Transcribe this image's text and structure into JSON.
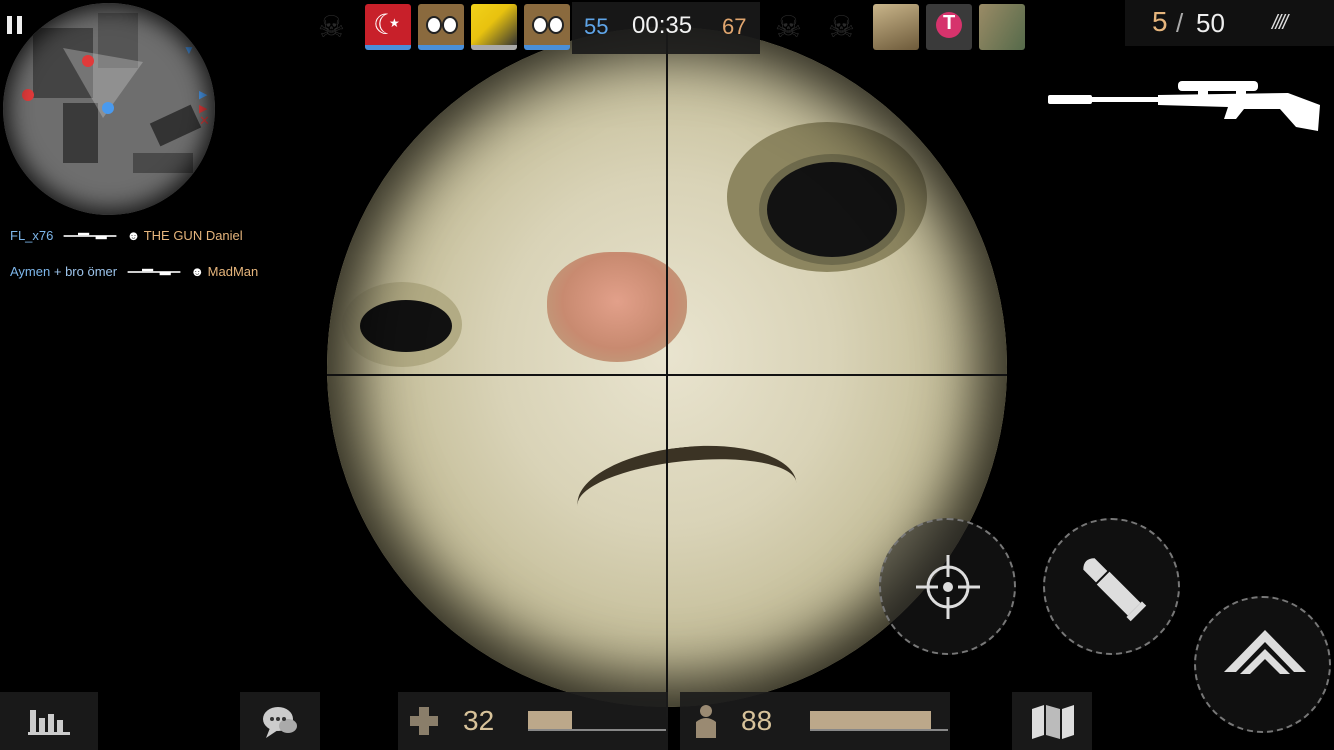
{
  "top": {
    "score_blue": "55",
    "timer": "00:35",
    "score_red": "67"
  },
  "ammo": {
    "current": "5",
    "separator": "/",
    "total": "50",
    "mags": "////"
  },
  "killfeed": [
    {
      "killer": "FL_x76",
      "assist": "",
      "victim": "THE GUN Daniel"
    },
    {
      "killer": "Aymen",
      "assist": "+ bro ömer",
      "victim": "MadMan"
    }
  ],
  "player": {
    "health": "32",
    "health_fraction": 0.32,
    "armor": "88",
    "armor_fraction": 0.88
  },
  "icons": [
    "pause-icon",
    "skull-icon",
    "sniper-rifle-icon",
    "stats-icon",
    "chat-icon",
    "health-cross-icon",
    "armor-icon",
    "map-icon",
    "scope-aim-icon",
    "reload-bullet-icon",
    "jump-chevron-icon"
  ],
  "colors": {
    "team_blue": "#5fa5e8",
    "team_red": "#e0a56e",
    "enemy_dot": "#e03a3a",
    "ally_dot": "#4a9aee"
  }
}
